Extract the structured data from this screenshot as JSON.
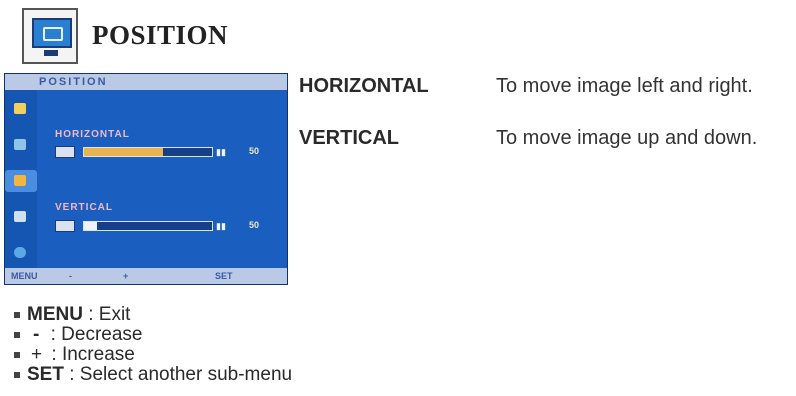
{
  "header": {
    "title": "POSITION",
    "icon": "monitor-position-icon"
  },
  "osd": {
    "title": "POSITION",
    "sidebar_icons": [
      "picture-icon",
      "color-icon",
      "position-icon",
      "setup-icon",
      "special-icon"
    ],
    "horizontal": {
      "label": "HORIZONTAL",
      "value": "50",
      "fill": 0.62
    },
    "vertical": {
      "label": "VERTICAL",
      "value": "50",
      "fill": 0.1
    },
    "footer": {
      "menu": "MENU",
      "decrease": "-",
      "increase": "+",
      "set": "SET"
    },
    "colors": {
      "background": "#1a5fbf",
      "title_bar": "#b9c9e6",
      "accent": "#e9b450"
    }
  },
  "descriptions": [
    {
      "term": "HORIZONTAL",
      "text": "To move image left and right."
    },
    {
      "term": "VERTICAL",
      "text": "To move image up and down."
    }
  ],
  "keys": [
    {
      "key": "MENU",
      "text": ": Exit"
    },
    {
      "key": "-",
      "text": ": Decrease"
    },
    {
      "key": "+",
      "text": ": Increase"
    },
    {
      "key": "SET",
      "text": ": Select another sub-menu"
    }
  ]
}
